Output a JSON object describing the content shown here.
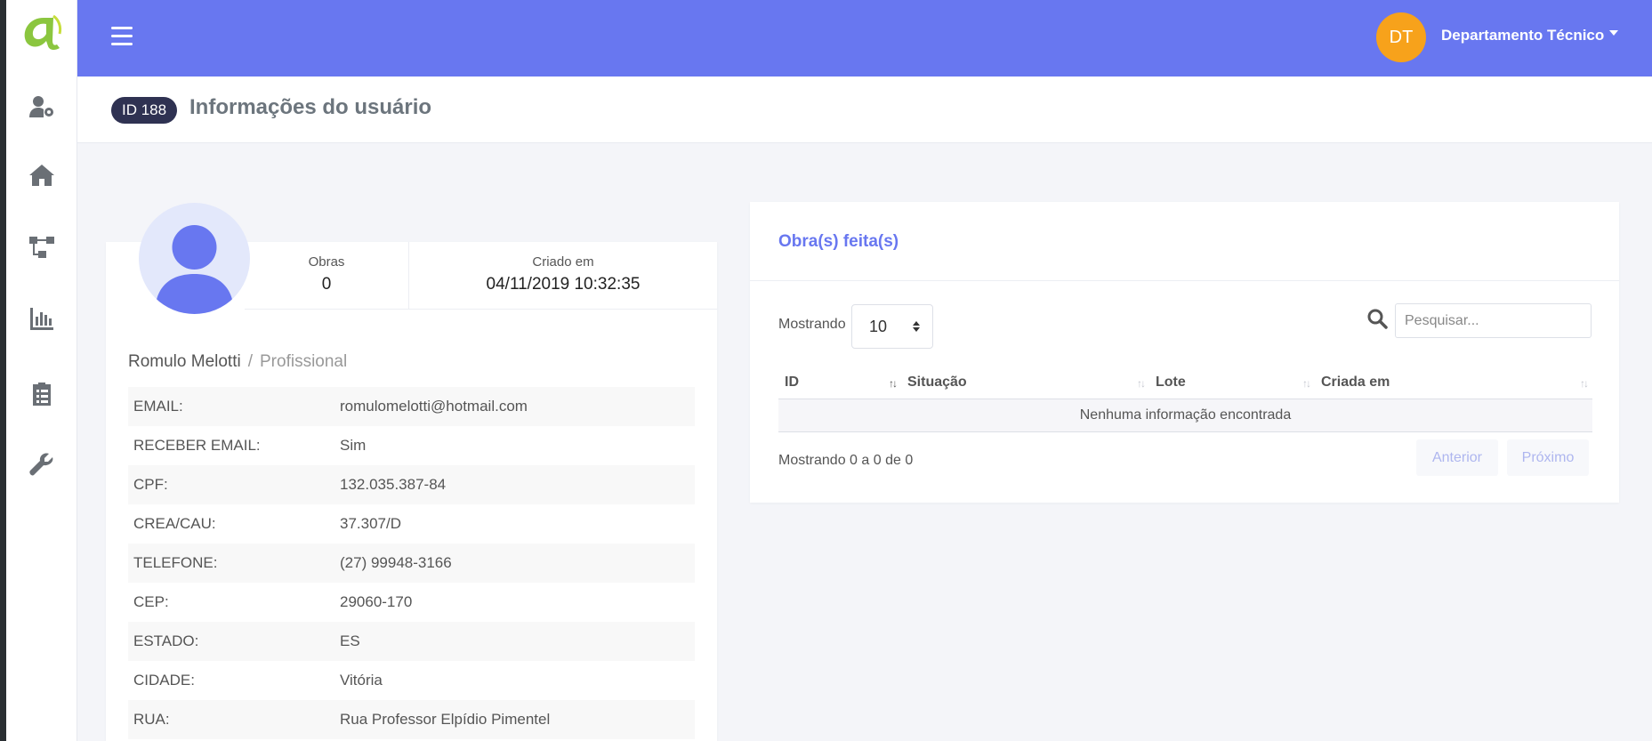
{
  "topbar": {
    "avatar_initials": "DT",
    "user_name": "Departamento Técnico",
    "accent_color": "#6877f0"
  },
  "sidebar": {
    "items": [
      {
        "icon": "user-cog-icon"
      },
      {
        "icon": "home-icon"
      },
      {
        "icon": "sitemap-icon"
      },
      {
        "icon": "bar-chart-icon"
      },
      {
        "icon": "clipboard-list-icon"
      },
      {
        "icon": "wrench-icon"
      }
    ]
  },
  "header": {
    "id_badge": "ID 188",
    "title": "Informações do usuário"
  },
  "profile": {
    "stats": [
      {
        "label": "Obras",
        "value": "0"
      },
      {
        "label": "Criado em",
        "value": "04/11/2019 10:32:35"
      }
    ],
    "name": "Romulo Melotti",
    "separator": "/",
    "role": "Profissional",
    "fields": [
      {
        "label": "EMAIL:",
        "value": "romulomelotti@hotmail.com"
      },
      {
        "label": "RECEBER EMAIL:",
        "value": "Sim"
      },
      {
        "label": "CPF:",
        "value": "132.035.387-84"
      },
      {
        "label": "CREA/CAU:",
        "value": "37.307/D"
      },
      {
        "label": "TELEFONE:",
        "value": "(27) 99948-3166"
      },
      {
        "label": "CEP:",
        "value": "29060-170"
      },
      {
        "label": "ESTADO:",
        "value": "ES"
      },
      {
        "label": "CIDADE:",
        "value": "Vitória"
      },
      {
        "label": "RUA:",
        "value": "Rua Professor Elpídio Pimentel"
      }
    ]
  },
  "obras": {
    "title": "Obra(s) feita(s)",
    "length_label": "Mostrando",
    "length_value": "10",
    "search_placeholder": "Pesquisar...",
    "columns": [
      "ID",
      "Situação",
      "Lote",
      "Criada em"
    ],
    "empty_text": "Nenhuma informação encontrada",
    "info_text": "Mostrando 0 a 0 de 0",
    "prev_label": "Anterior",
    "next_label": "Próximo"
  }
}
